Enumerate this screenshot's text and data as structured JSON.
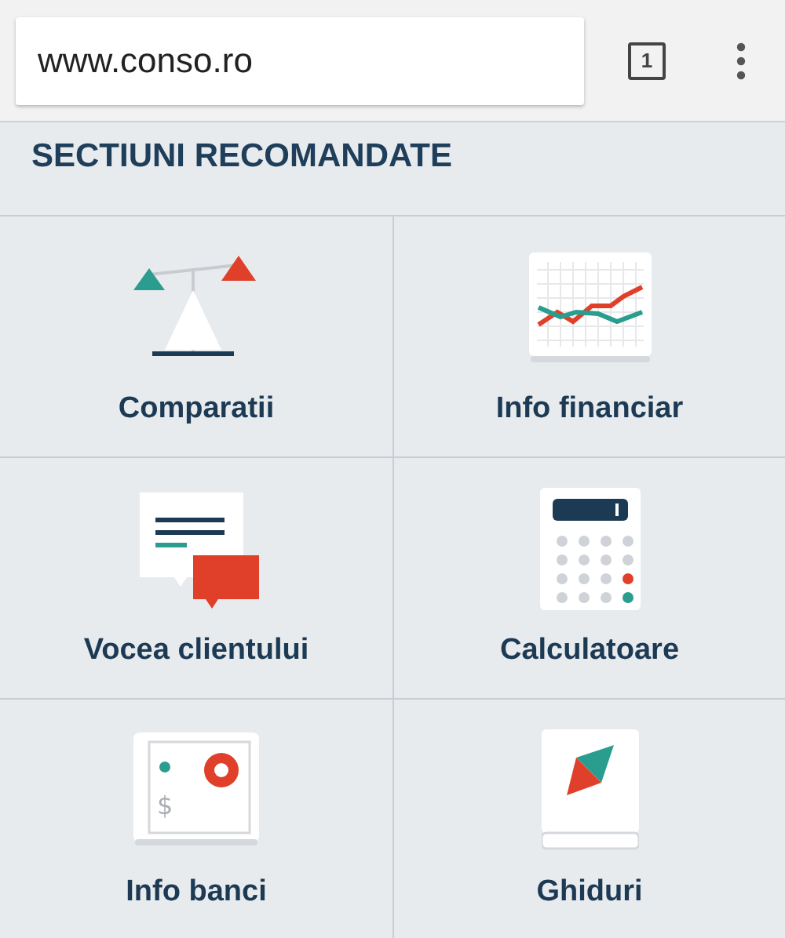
{
  "browser": {
    "url": "www.conso.ro",
    "tab_count": "1"
  },
  "section": {
    "title": "SECTIUNI RECOMANDATE",
    "items": [
      {
        "label": "Comparatii"
      },
      {
        "label": "Info financiar"
      },
      {
        "label": "Vocea clientului"
      },
      {
        "label": "Calculatoare"
      },
      {
        "label": "Info banci",
        "sign": "$"
      },
      {
        "label": "Ghiduri"
      }
    ]
  }
}
